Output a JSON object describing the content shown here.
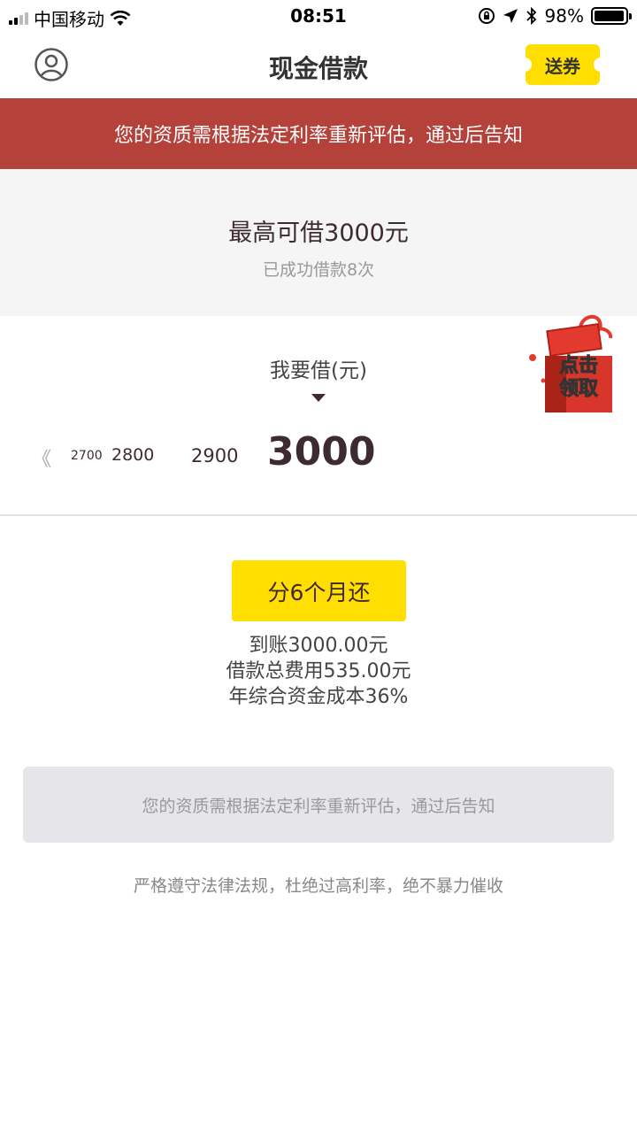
{
  "status_bar": {
    "carrier": "中国移动",
    "time": "08:51",
    "battery": "98%",
    "battery_level": 0.98
  },
  "nav": {
    "title": "现金借款",
    "coupon_label": "送券",
    "avatar_icon": "user-circle-icon"
  },
  "banner": {
    "text": "您的资质需根据法定利率重新评估，通过后告知",
    "color": "#b5413b"
  },
  "summary": {
    "max_amount": "最高可借3000元",
    "success_count": "已成功借款8次"
  },
  "selector": {
    "label": "我要借(元)",
    "values": [
      "2700",
      "2800",
      "2900",
      "3000"
    ],
    "selected": "3000"
  },
  "gift": {
    "line1": "点击",
    "line2": "领取"
  },
  "plan": {
    "button_label": "分6个月还",
    "received": "到账3000.00元",
    "total_fee": "借款总费用535.00元",
    "annual_rate": "年综合资金成本36%"
  },
  "notice": {
    "text": "您的资质需根据法定利率重新评估，通过后告知"
  },
  "footer": {
    "text": "严格遵守法律法规，杜绝过高利率，绝不暴力催收"
  },
  "colors": {
    "accent": "#ffde00",
    "dark_text": "#3d2b30"
  }
}
